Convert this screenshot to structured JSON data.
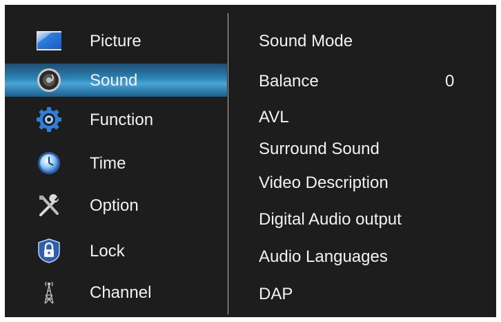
{
  "sidebar": {
    "items": [
      {
        "label": "Picture",
        "icon": "picture-icon",
        "selected": false
      },
      {
        "label": "Sound",
        "icon": "sound-icon",
        "selected": true
      },
      {
        "label": "Function",
        "icon": "function-icon",
        "selected": false
      },
      {
        "label": "Time",
        "icon": "time-icon",
        "selected": false
      },
      {
        "label": "Option",
        "icon": "option-icon",
        "selected": false
      },
      {
        "label": "Lock",
        "icon": "lock-icon",
        "selected": false
      },
      {
        "label": "Channel",
        "icon": "channel-icon",
        "selected": false
      }
    ]
  },
  "sound_menu": {
    "items": [
      {
        "label": "Sound Mode"
      },
      {
        "label": "Balance",
        "value": "0"
      },
      {
        "label": "AVL"
      },
      {
        "label": "Surround Sound"
      },
      {
        "label": "Video Description"
      },
      {
        "label": "Digital Audio output"
      },
      {
        "label": "Audio Languages"
      },
      {
        "label": "DAP"
      }
    ]
  },
  "colors": {
    "background": "#1e1d1d",
    "text": "#f2f2f2",
    "highlight": "#2b84b6",
    "divider": "#b8b8b8"
  }
}
